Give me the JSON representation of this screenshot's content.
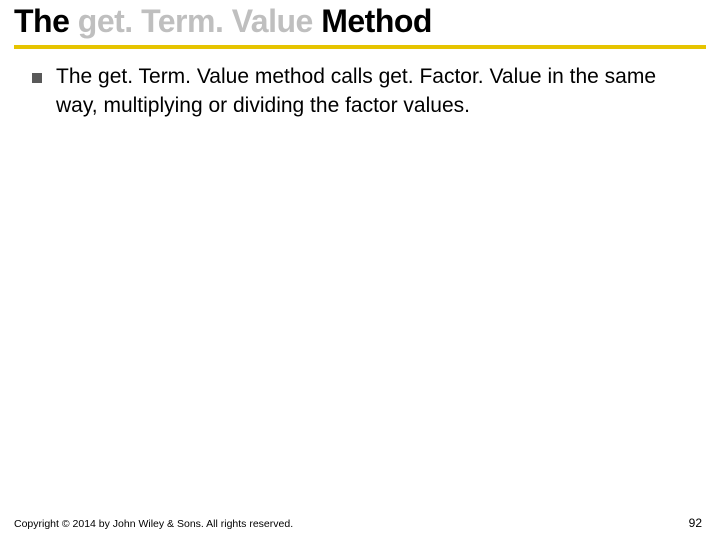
{
  "title": {
    "part1": "The ",
    "part2_light": "get. Term. Value ",
    "part3": "Method"
  },
  "bullet": {
    "seg1": "The ",
    "seg2": "get. Term. Value ",
    "seg3": "method calls ",
    "seg4": "get. Factor. Value ",
    "seg5": "in the same way, multiplying or dividing the factor values."
  },
  "footer": {
    "copyright": "Copyright © 2014 by John Wiley & Sons. All rights reserved.",
    "page": "92"
  }
}
